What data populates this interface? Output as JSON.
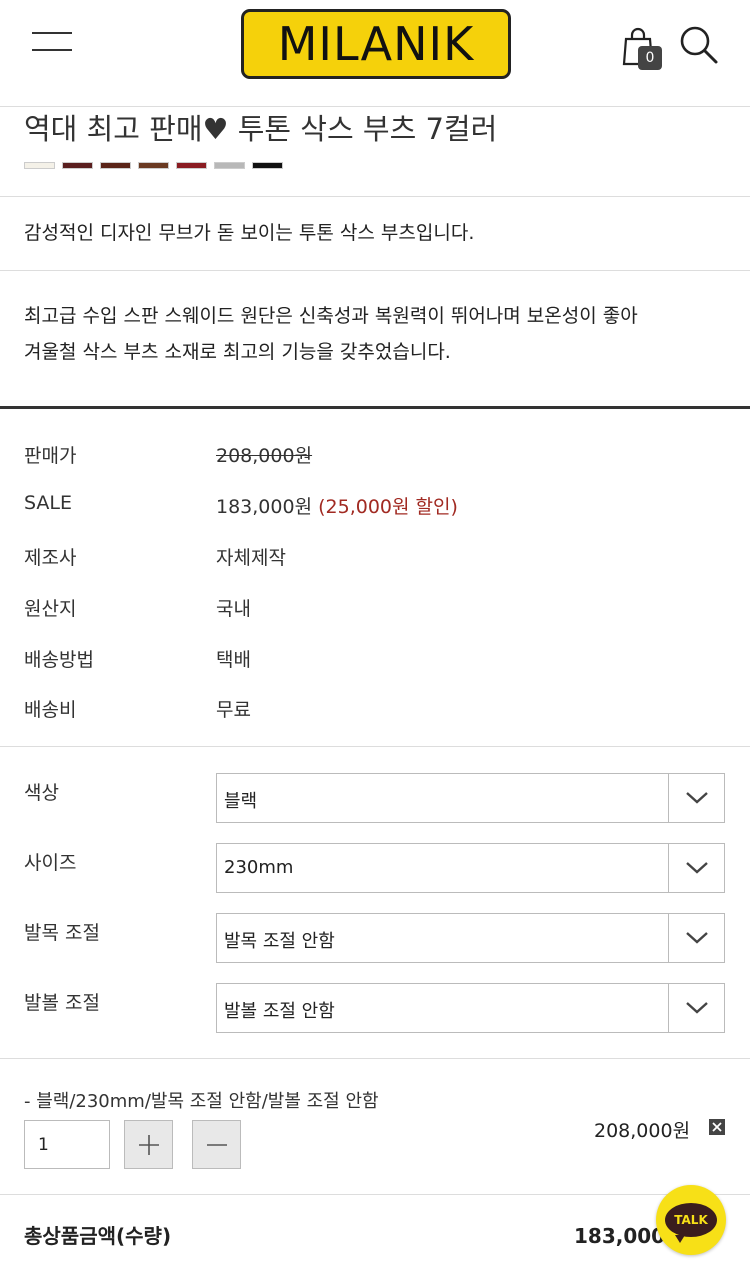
{
  "header": {
    "logo": "MILANIK",
    "cart_count": "0"
  },
  "product": {
    "title": "역대 최고 판매♥ 투톤 삭스 부츠 7컬러",
    "swatches": [
      "#f4f1e8",
      "#5a1f1f",
      "#5a2418",
      "#6a3a22",
      "#8a1c22",
      "#b8b8b8",
      "#111111"
    ],
    "desc_1": "감성적인 디자인 무브가 돋 보이는 투톤 삭스 부츠입니다.",
    "desc_2_line1": "최고급 수입 스판 스웨이드 원단은 신축성과 복원력이 뛰어나며 보온성이 좋아",
    "desc_2_line2": "겨울철 삭스 부츠 소재로 최고의 기능을 갖추었습니다."
  },
  "info": {
    "price_label": "판매가",
    "price_value": "208,000원",
    "sale_label": "SALE",
    "sale_value": "183,000원",
    "sale_discount": "(25,000원 할인)",
    "maker_label": "제조사",
    "maker_value": "자체제작",
    "origin_label": "원산지",
    "origin_value": "국내",
    "shipping_method_label": "배송방법",
    "shipping_method_value": "택배",
    "shipping_fee_label": "배송비",
    "shipping_fee_value": "무료"
  },
  "options": {
    "color_label": "색상",
    "color_value": "블랙",
    "size_label": "사이즈",
    "size_value": "230mm",
    "ankle_label": "발목 조절",
    "ankle_value": "발목 조절 안함",
    "ball_label": "발볼 조절",
    "ball_value": "발볼 조절 안함"
  },
  "selected": {
    "summary": "- 블랙/230mm/발목 조절 안함/발볼 조절 안함",
    "quantity": "1",
    "price": "208,000원"
  },
  "total": {
    "label": "총상품금액(수량)",
    "value": "183,000원"
  },
  "talk_label": "TALK"
}
